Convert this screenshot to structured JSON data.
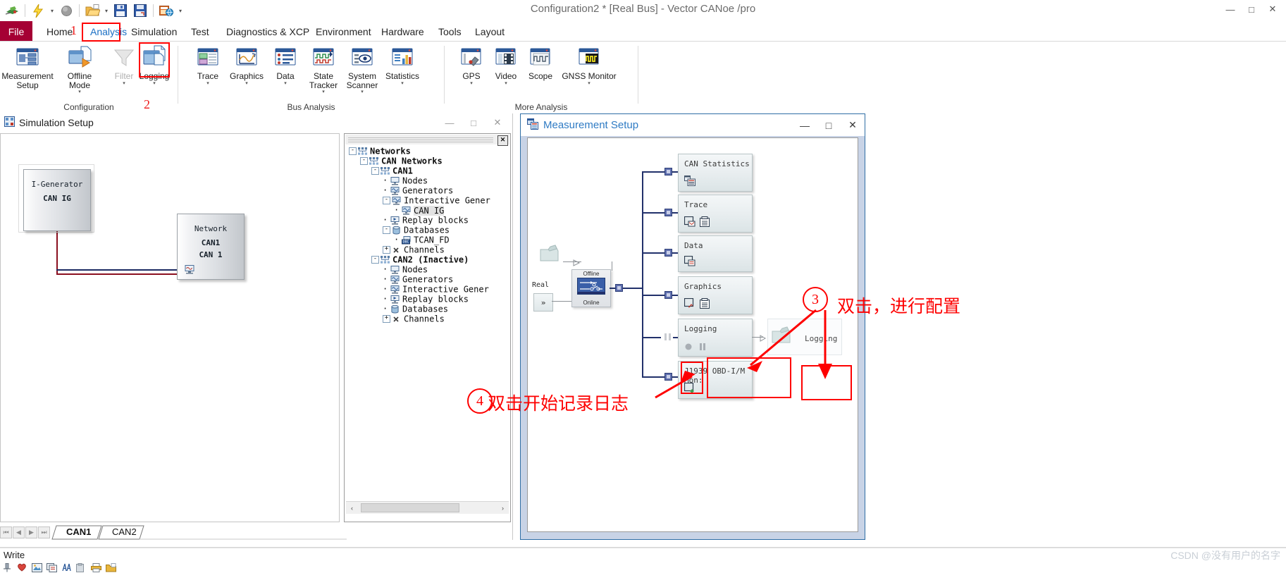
{
  "window": {
    "title": "Configuration2 * [Real Bus] - Vector CANoe /pro",
    "minimize": "—",
    "maximize": "□",
    "close": "✕"
  },
  "quick_access": {
    "items": [
      {
        "name": "canoe-app-icon",
        "label": ""
      },
      {
        "name": "start-measurement-icon",
        "label": ""
      },
      {
        "name": "qat-dropdown-1",
        "label": "▾"
      },
      {
        "name": "stop-measurement-icon",
        "label": ""
      },
      {
        "name": "open-configuration-icon",
        "label": ""
      },
      {
        "name": "qat-dropdown-2",
        "label": "▾"
      },
      {
        "name": "save-configuration-icon",
        "label": ""
      },
      {
        "name": "save-as-icon",
        "label": ""
      },
      {
        "name": "publish-icon",
        "label": ""
      },
      {
        "name": "customize-qat-icon",
        "label": "▾"
      }
    ]
  },
  "ribbon": {
    "file_tab": "File",
    "tabs": [
      {
        "label": "Home",
        "active": false
      },
      {
        "label": "Analysis",
        "active": true
      },
      {
        "label": "Simulation",
        "active": false
      },
      {
        "label": "Test",
        "active": false
      },
      {
        "label": "Diagnostics & XCP",
        "active": false
      },
      {
        "label": "Environment",
        "active": false
      },
      {
        "label": "Hardware",
        "active": false
      },
      {
        "label": "Tools",
        "active": false
      },
      {
        "label": "Layout",
        "active": false
      }
    ],
    "groups": [
      {
        "name": "configuration",
        "label": "Configuration",
        "items": [
          {
            "label": "Measurement\nSetup",
            "icon": "measurement-setup-icon",
            "caret": false,
            "disabled": false,
            "highlighted": false
          },
          {
            "label": "Offline\nMode",
            "icon": "offline-mode-icon",
            "caret": true,
            "disabled": false,
            "highlighted": false
          },
          {
            "label": "Filter",
            "icon": "filter-icon",
            "caret": true,
            "disabled": true,
            "highlighted": false
          },
          {
            "label": "Logging",
            "icon": "logging-icon",
            "caret": true,
            "disabled": false,
            "highlighted": true
          }
        ]
      },
      {
        "name": "bus-analysis",
        "label": "Bus Analysis",
        "items": [
          {
            "label": "Trace",
            "icon": "trace-icon",
            "caret": true,
            "disabled": false,
            "highlighted": false
          },
          {
            "label": "Graphics",
            "icon": "graphics-icon",
            "caret": true,
            "disabled": false,
            "highlighted": false
          },
          {
            "label": "Data",
            "icon": "data-icon",
            "caret": true,
            "disabled": false,
            "highlighted": false
          },
          {
            "label": "State\nTracker",
            "icon": "state-tracker-icon",
            "caret": true,
            "disabled": false,
            "highlighted": false
          },
          {
            "label": "System\nScanner",
            "icon": "system-scanner-icon",
            "caret": true,
            "disabled": false,
            "highlighted": false
          },
          {
            "label": "Statistics",
            "icon": "statistics-icon",
            "caret": true,
            "disabled": false,
            "highlighted": false
          }
        ]
      },
      {
        "name": "more-analysis",
        "label": "More Analysis",
        "items": [
          {
            "label": "GPS",
            "icon": "gps-icon",
            "caret": true,
            "disabled": false,
            "highlighted": false
          },
          {
            "label": "Video",
            "icon": "video-icon",
            "caret": true,
            "disabled": false,
            "highlighted": false
          },
          {
            "label": "Scope",
            "icon": "scope-icon",
            "caret": false,
            "disabled": false,
            "highlighted": false
          },
          {
            "label": "GNSS Monitor",
            "icon": "gnss-monitor-icon",
            "caret": true,
            "disabled": false,
            "highlighted": false
          }
        ]
      }
    ]
  },
  "simulation_setup": {
    "title": "Simulation Setup",
    "window_controls": {
      "minimize": "—",
      "maximize": "□",
      "close": "✕"
    },
    "blocks": [
      {
        "name": "can-ig-node",
        "line1": "I-Generator",
        "line2": "CAN IG",
        "line3": ""
      },
      {
        "name": "network-node",
        "line1": "Network",
        "line2": "CAN1",
        "line3": "CAN 1"
      }
    ],
    "sheet_tabs": [
      {
        "label": "CAN1",
        "active": true
      },
      {
        "label": "CAN2",
        "active": false
      }
    ],
    "nav_buttons": [
      "⏮",
      "◀",
      "▶",
      "⏭"
    ]
  },
  "tree": {
    "close_label": "✕",
    "scroll_left": "‹",
    "scroll_right": "›",
    "rows": [
      {
        "indent": 0,
        "toggle": "-",
        "icon": "network-group-icon",
        "label": "Networks",
        "bold": true,
        "selected": false
      },
      {
        "indent": 1,
        "toggle": "-",
        "icon": "network-group-icon",
        "label": "CAN Networks",
        "bold": true,
        "selected": false
      },
      {
        "indent": 2,
        "toggle": "-",
        "icon": "network-group-icon",
        "label": "CAN1",
        "bold": true,
        "selected": false
      },
      {
        "indent": 3,
        "toggle": "",
        "icon": "node-icon",
        "label": "Nodes",
        "bold": false,
        "selected": false
      },
      {
        "indent": 3,
        "toggle": "",
        "icon": "generator-icon",
        "label": "Generators",
        "bold": false,
        "selected": false
      },
      {
        "indent": 3,
        "toggle": "-",
        "icon": "generator-icon",
        "label": "Interactive Gener",
        "bold": false,
        "selected": false
      },
      {
        "indent": 4,
        "toggle": "",
        "icon": "generator-icon",
        "label": "CAN IG",
        "bold": false,
        "selected": true
      },
      {
        "indent": 3,
        "toggle": "",
        "icon": "replay-icon",
        "label": "Replay blocks",
        "bold": false,
        "selected": false
      },
      {
        "indent": 3,
        "toggle": "-",
        "icon": "database-icon",
        "label": "Databases",
        "bold": false,
        "selected": false
      },
      {
        "indent": 4,
        "toggle": "",
        "icon": "dbc-icon",
        "label": "TCAN_FD",
        "bold": false,
        "selected": false
      },
      {
        "indent": 3,
        "toggle": "+",
        "icon": "channels-icon",
        "label": "Channels",
        "bold": false,
        "selected": false
      },
      {
        "indent": 2,
        "toggle": "-",
        "icon": "network-group-icon",
        "label": "CAN2 (Inactive)",
        "bold": true,
        "selected": false
      },
      {
        "indent": 3,
        "toggle": "",
        "icon": "node-icon",
        "label": "Nodes",
        "bold": false,
        "selected": false
      },
      {
        "indent": 3,
        "toggle": "",
        "icon": "generator-icon",
        "label": "Generators",
        "bold": false,
        "selected": false
      },
      {
        "indent": 3,
        "toggle": "",
        "icon": "generator-icon",
        "label": "Interactive Gener",
        "bold": false,
        "selected": false
      },
      {
        "indent": 3,
        "toggle": "",
        "icon": "replay-icon",
        "label": "Replay blocks",
        "bold": false,
        "selected": false
      },
      {
        "indent": 3,
        "toggle": "",
        "icon": "database-icon",
        "label": "Databases",
        "bold": false,
        "selected": false
      },
      {
        "indent": 3,
        "toggle": "+",
        "icon": "channels-icon",
        "label": "Channels",
        "bold": false,
        "selected": false
      }
    ]
  },
  "measurement_setup": {
    "title": "Measurement Setup",
    "window_controls": {
      "minimize": "—",
      "maximize": "□",
      "close": "✕"
    },
    "switch": {
      "offline_label": "Offline",
      "online_label": "Online"
    },
    "real_label": "Real",
    "real_button": "»",
    "blocks": [
      {
        "name": "can-statistics-block",
        "label": "CAN Statistics",
        "icons": [
          "statistics-window-icon"
        ]
      },
      {
        "name": "trace-block",
        "label": "Trace",
        "icons": [
          "trace-window-icon",
          "list-icon"
        ]
      },
      {
        "name": "data-block",
        "label": "Data",
        "icons": [
          "data-window-icon"
        ]
      },
      {
        "name": "graphics-block",
        "label": "Graphics",
        "icons": [
          "graphics-window-icon",
          "list-icon"
        ]
      },
      {
        "name": "logging-block",
        "label": "Logging",
        "icons": [
          "record-dot-icon",
          "pause-icon"
        ]
      },
      {
        "name": "j1939-block",
        "label": "J1939 OBD-I/M Mon:",
        "icons": [
          "j1939-window-icon"
        ]
      }
    ],
    "logging_file_block": {
      "name": "logging-file-block",
      "label": "Logging",
      "icon": "folder-icon"
    }
  },
  "annotations": [
    {
      "name": "annotation-1",
      "marker": "1",
      "text": ""
    },
    {
      "name": "annotation-2",
      "marker": "2",
      "text": ""
    },
    {
      "name": "annotation-3",
      "marker": "3",
      "text": "双击，进行配置"
    },
    {
      "name": "annotation-4",
      "marker": "4",
      "text": "双击开始记录日志"
    }
  ],
  "status_bar": {
    "write_label": "Write",
    "icons": [
      "pin-icon",
      "favorite-icon",
      "image-icon",
      "copy-icon",
      "find-icon",
      "clipboard-icon",
      "print-icon",
      "folder-icon"
    ]
  },
  "watermark": "CSDN @没有用户的名字",
  "colors": {
    "file_tab": "#a50034",
    "active_tab_text": "#1a6fc4",
    "annotation_red": "#fe0000",
    "wire_blue": "#22316b",
    "meas_window_frame": "#2f6ea5",
    "meas_window_bg": "#c8d3e6"
  }
}
